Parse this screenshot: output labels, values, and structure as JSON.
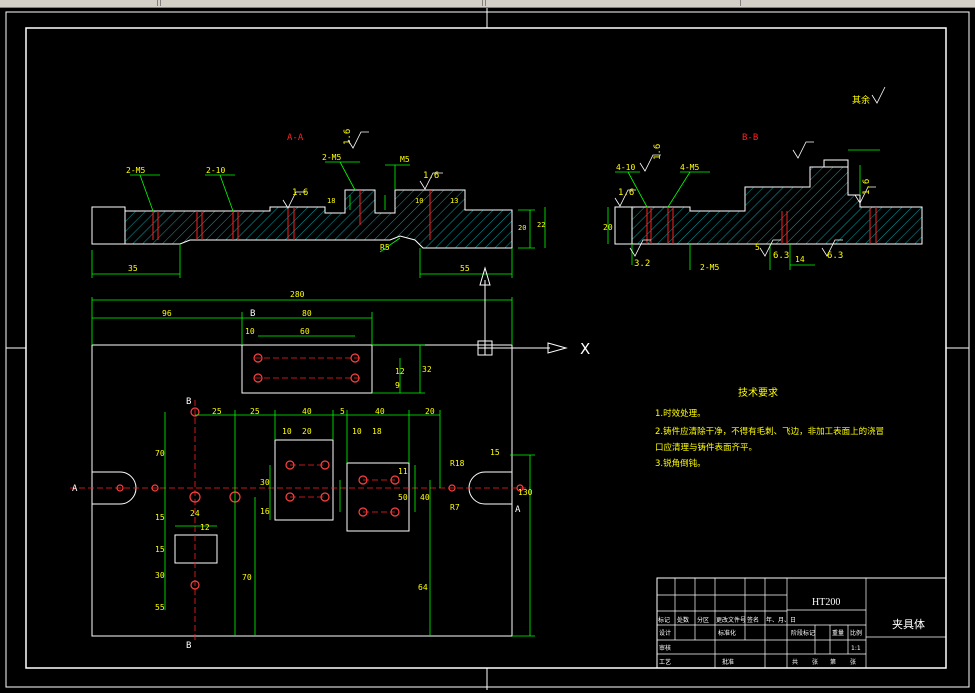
{
  "section_aa": {
    "label": "A-A",
    "roughness_a": "1.6",
    "roughness_b": "1.6",
    "roughness_c": "1.6",
    "roughness_d": "1.6",
    "hole_left_1": "2-M5",
    "hole_left_2": "2-10",
    "hole_center": "2-M5",
    "thread_m5": "M5",
    "radius": "R5",
    "dim_left": "35",
    "dim_right": "55",
    "dim_height_a": "20",
    "dim_height_b": "22",
    "dim_small_a": "10",
    "dim_small_b": "13",
    "dim_small_c": "18"
  },
  "section_bb": {
    "label": "B-B",
    "roughness_a": "1.6",
    "roughness_b": "1.6",
    "roughness_c": "1.6",
    "roughness_d": "3.2",
    "roughness_e": "6.3",
    "roughness_f": "6.3",
    "hole_a": "4-10",
    "hole_b": "4-M5",
    "hole_c": "2-M5",
    "dim_height": "20",
    "dim_fit": "14",
    "dim_small": "5"
  },
  "corner_note": "其余",
  "plan_view": {
    "dim_total": "280",
    "dim_96": "96",
    "dim_80": "80",
    "dim_60": "60",
    "dim_10a": "10",
    "dim_32": "32",
    "dim_12": "12",
    "dim_9": "9",
    "label_b_top": "B",
    "label_b_bottom": "B",
    "label_b_mid": "B",
    "label_a_left": "A",
    "label_a_right": "A",
    "dim_25a": "25",
    "dim_25b": "25",
    "dim_40a": "40",
    "dim_5": "5",
    "dim_40b": "40",
    "dim_20a": "20",
    "dim_10b": "10",
    "dim_20b": "20",
    "dim_10c": "10",
    "dim_18": "18",
    "dim_r18": "R18",
    "dim_r7": "R7",
    "dim_15": "15",
    "dim_130": "130",
    "dim_24": "24",
    "dim_12b": "12",
    "dim_70": "70",
    "dim_64": "64",
    "dim_40c": "40",
    "dim_30": "30",
    "dim_11": "11",
    "dim_16": "16",
    "dim_50": "50",
    "dim_70b": "70",
    "dim_15b": "15",
    "dim_15c": "15",
    "dim_30b": "30",
    "dim_55": "55"
  },
  "technical_requirements": {
    "title": "技术要求",
    "items": [
      "1.时效处理。",
      "2.铸件应清除干净，不得有毛刺、飞边，非加工表面上的浇冒",
      "口应清理与铸件表面齐平。",
      "3.锐角倒钝。"
    ]
  },
  "ucs": {
    "axis_x": "X"
  },
  "title_block": {
    "material": "HT200",
    "part_name": "夹具体",
    "row_headers": [
      "标记",
      "处数",
      "分区",
      "更改文件号",
      "签名",
      "年、月、日"
    ],
    "design": "设计",
    "standardize": "标准化",
    "stage_mark": "阶段标记",
    "weight": "重量",
    "scale": "比例",
    "scale_value": "1:1",
    "review": "审核",
    "process": "工艺",
    "approve": "批准",
    "total_sheets": "共",
    "sheet": "张",
    "page": "第",
    "page_unit": "张"
  }
}
